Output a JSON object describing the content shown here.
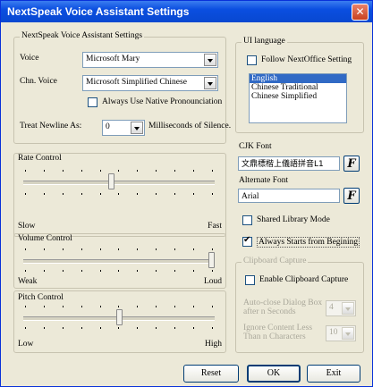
{
  "window": {
    "title": "NextSpeak Voice Assistant Settings",
    "close_glyph": "✕"
  },
  "left_group": {
    "title": "NextSpeak Voice Assistant Settings",
    "voice_label": "Voice",
    "voice_value": "Microsoft Mary",
    "chn_voice_label": "Chn. Voice",
    "chn_voice_value": "Microsoft Simplified Chinese",
    "native_pron_label": "Always Use Native Pronounciation",
    "native_pron_checked": false,
    "newline_label": "Treat Newline As:",
    "newline_value": "0",
    "newline_suffix": "Milliseconds of Silence."
  },
  "rate": {
    "title": "Rate Control",
    "min_label": "Slow",
    "max_label": "Fast",
    "level": 0.46
  },
  "volume": {
    "title": "Volume Control",
    "min_label": "Weak",
    "max_label": "Loud",
    "level": 1.0
  },
  "pitch": {
    "title": "Pitch Control",
    "min_label": "Low",
    "max_label": "High",
    "level": 0.5
  },
  "ui_language": {
    "title": "UI language",
    "follow_label": "Follow NextOffice Setting",
    "follow_checked": false,
    "options": [
      "English",
      "Chinese Traditional",
      "Chinese Simplified"
    ],
    "selected": "English"
  },
  "fonts": {
    "cjk_label": "CJK Font",
    "cjk_value": "文鼎標楷上儀語拼音L1",
    "alternate_label": "Alternate Font",
    "alternate_value": "Arial",
    "font_button_glyph": "F"
  },
  "shared_library": {
    "label": "Shared Library Mode",
    "checked": false
  },
  "always_start": {
    "label": "Always Starts from Begining",
    "checked": true
  },
  "clipboard": {
    "title": "Clipboard Capture",
    "enable_label": "Enable Clipboard Capture",
    "enable_checked": false,
    "autoclose_label": "Auto-close Dialog Box after n Seconds",
    "autoclose_value": "4",
    "ignore_label": "Ignore Content Less Than n Characters",
    "ignore_value": "10"
  },
  "buttons": {
    "reset": "Reset",
    "ok": "OK",
    "exit": "Exit"
  }
}
